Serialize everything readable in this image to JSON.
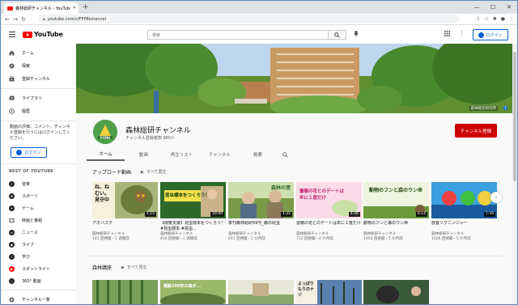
{
  "browser": {
    "tab_title": "森林総研チャンネル - YouTube",
    "url": "youtube.com/c/FFPRIchannel"
  },
  "header": {
    "logo_text": "YouTube",
    "search_placeholder": "検索",
    "login_label": "ログイン"
  },
  "sidebar": {
    "items": [
      {
        "label": "ホーム",
        "icon": "home-icon"
      },
      {
        "label": "探索",
        "icon": "compass-icon"
      },
      {
        "label": "登録チャンネル",
        "icon": "subscriptions-icon"
      },
      {
        "label": "ライブラリ",
        "icon": "library-icon"
      },
      {
        "label": "履歴",
        "icon": "history-icon"
      }
    ],
    "signin_text": "動画の評価、コメント、チャンネル登録を行うにはログインしてください。",
    "signin_button": "ログイン",
    "best_header": "BEST OF YOUTUBE",
    "best_items": [
      {
        "label": "音楽",
        "icon": "music-icon"
      },
      {
        "label": "スポーツ",
        "icon": "trophy-icon"
      },
      {
        "label": "ゲーム",
        "icon": "gamepad-icon"
      },
      {
        "label": "映画と番組",
        "icon": "film-icon"
      },
      {
        "label": "ニュース",
        "icon": "news-icon"
      },
      {
        "label": "ライブ",
        "icon": "live-icon"
      },
      {
        "label": "学び",
        "icon": "bulb-icon"
      },
      {
        "label": "スポットライト",
        "icon": "spotlight-icon"
      },
      {
        "label": "360° 動画",
        "icon": "360-icon"
      }
    ],
    "more_label": "チャンネル一覧"
  },
  "banner": {
    "caption": "森林総合研究所"
  },
  "channel": {
    "logo_text": "FFPRI",
    "name": "森林総研チャンネル",
    "subscribers": "チャンネル登録者数 980人",
    "subscribe_label": "チャンネル登録",
    "tabs": [
      "ホーム",
      "動画",
      "再生リスト",
      "チャンネル",
      "概要"
    ],
    "active_tab": "ホーム"
  },
  "shelf1": {
    "title": "アップロード動画",
    "play_all": "すべて再生",
    "videos": [
      {
        "title": "アオバズク",
        "channel": "森林総研チャンネル",
        "meta": "141 回視聴・1 週間前",
        "duration": "1:15",
        "overlay": "ね、ねむい。見守中"
      },
      {
        "title": "【閲覧支援】昆虫標本をつくろう！ #昆虫標本 #昆虫...",
        "channel": "森林総研チャンネル",
        "meta": "414 回視聴・1 週間前",
        "duration": "10:40",
        "overlay": "昆虫標本をつくろう！"
      },
      {
        "title": "季刊森林総研59号_森の昆虫",
        "channel": "森林総研チャンネル",
        "meta": "611 回視聴・2 か月前",
        "duration": "1:31",
        "overlay": "森林の室"
      },
      {
        "title": "薔薇の花とのデートは年に１度だけ",
        "channel": "森林総研チャンネル",
        "meta": "712 回視聴・4 か月前",
        "duration": "4:46",
        "overlay": "薔薇の花とのデートは年に１度だけ"
      },
      {
        "title": "動物のフンと森のウン命",
        "channel": "森林総研チャンネル",
        "meta": "1054 回視聴・5 か月前",
        "duration": "6:14",
        "overlay": "動物のフンと森のウン命"
      },
      {
        "title": "放置リグニンジャー",
        "channel": "森林総研チャンネル",
        "meta": "1026 回視聴・5 か月前",
        "duration": "7:39",
        "overlay": ""
      }
    ]
  },
  "shelf2": {
    "title": "森林講座",
    "play_all": "すべて再生",
    "overlays": [
      "",
      "樹齢200年の森が...",
      "",
      "よっぽり もりのナゾ",
      ""
    ]
  }
}
